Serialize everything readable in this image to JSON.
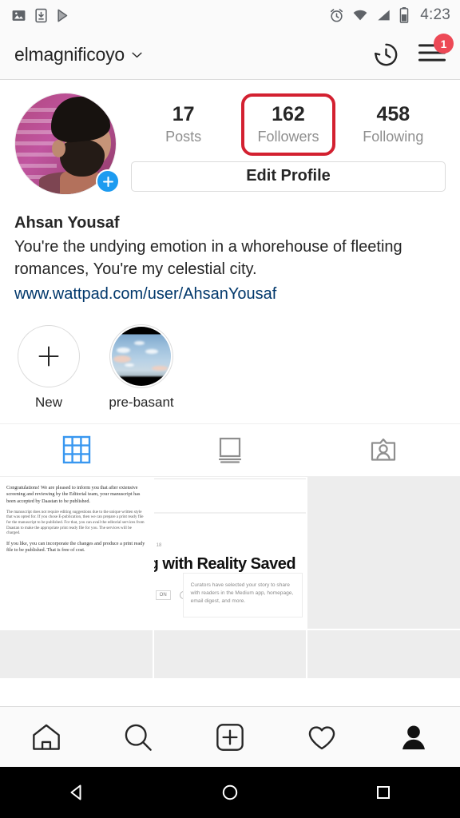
{
  "status_bar": {
    "time": "4:23",
    "left_icons": [
      "photo-icon",
      "download-icon",
      "play-store-icon"
    ],
    "right_icons": [
      "alarm-icon",
      "wifi-icon",
      "signal-icon",
      "battery-icon"
    ]
  },
  "header": {
    "username": "elmagnificoyo",
    "dropdown_icon": "chevron-down-icon",
    "history_icon": "archive-history-icon",
    "menu_icon": "hamburger-menu-icon",
    "menu_badge": "1"
  },
  "profile": {
    "avatar_name": "profile-avatar",
    "add_story_label": "+",
    "stats": [
      {
        "value": "17",
        "label": "Posts",
        "highlighted": false
      },
      {
        "value": "162",
        "label": "Followers",
        "highlighted": true
      },
      {
        "value": "458",
        "label": "Following",
        "highlighted": false
      }
    ],
    "edit_profile_label": "Edit Profile",
    "bio_name": "Ahsan Yousaf",
    "bio_text": "You're the undying emotion in a whorehouse of fleeting romances, You're my celestial city.",
    "bio_link": "www.wattpad.com/user/AhsanYousaf"
  },
  "highlights": [
    {
      "label": "New",
      "type": "add"
    },
    {
      "label": "pre-basant",
      "type": "image"
    }
  ],
  "tabs": [
    {
      "name": "grid-tab",
      "icon": "grid-icon",
      "active": true
    },
    {
      "name": "list-tab",
      "icon": "list-view-icon",
      "active": false
    },
    {
      "name": "tagged-tab",
      "icon": "tagged-icon",
      "active": false
    }
  ],
  "posts": {
    "post1": {
      "para1": "Congratulations! We are pleased to inform you that after extensive screening and reviewing by the Editorial team, your manuscript has been accepted by Daastan to be published.",
      "para2": "The manuscript does not require editing suggestions due to the unique written style that was opted for. If you chose E-publication, then we can prepare a print ready file for the manuscript to be published. For that, you can avail the editorial services from Daastan to make the appropriate print ready file for you. The services will be charged.",
      "para3": "If you like, you can incorporate the changes and produce a print ready file to be published. That is free of cost."
    },
    "post2": {
      "number": "18",
      "title": "g with Reality Saved",
      "tag": "ON",
      "card_text": "Curators have selected your story to share with readers in the Medium app, homepage, email digest, and more."
    }
  },
  "bottom_nav": [
    {
      "name": "home-nav",
      "icon": "home-icon",
      "active": false
    },
    {
      "name": "search-nav",
      "icon": "search-icon",
      "active": false
    },
    {
      "name": "add-nav",
      "icon": "add-box-icon",
      "active": false
    },
    {
      "name": "activity-nav",
      "icon": "heart-icon",
      "active": false
    },
    {
      "name": "profile-nav",
      "icon": "person-icon",
      "active": true
    }
  ],
  "android_nav": [
    {
      "name": "back-button",
      "icon": "triangle-back-icon"
    },
    {
      "name": "home-button",
      "icon": "circle-home-icon"
    },
    {
      "name": "recents-button",
      "icon": "square-recents-icon"
    }
  ],
  "colors": {
    "accent_blue": "#1d9bf0",
    "tab_active": "#3897f0",
    "badge_red": "#ed4956",
    "highlight_red": "#d32030",
    "link_blue": "#00376b",
    "muted_gray": "#8e8e8e"
  }
}
